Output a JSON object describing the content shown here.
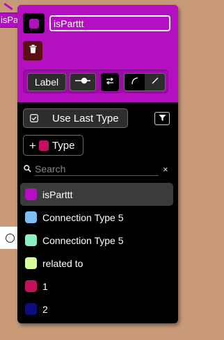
{
  "canvas": {
    "tag_label": "isPartt"
  },
  "editor": {
    "color": "#b40fc0",
    "name_value": "isParttt",
    "delete_icon": "trash-icon",
    "toolbar": {
      "label_button": "Label",
      "arrow_icon": "arrow-direction-icon",
      "swap_icon": "swap-icon",
      "curve_icon": "curved-line-icon",
      "straight_icon": "straight-line-icon"
    },
    "use_last_type_label": "Use Last Type",
    "filter_icon": "filter-icon",
    "add_type": {
      "plus": "+",
      "color": "#c4115e",
      "label": "Type"
    },
    "search": {
      "placeholder": "Search",
      "clear": "×"
    },
    "types": [
      {
        "label": "isParttt",
        "color": "#b40fc0",
        "selected": true
      },
      {
        "label": "Connection Type 5",
        "color": "#7dbdf0",
        "selected": false
      },
      {
        "label": "Connection Type 5",
        "color": "#8cf0c0",
        "selected": false
      },
      {
        "label": "related to",
        "color": "#d8fca0",
        "selected": false
      },
      {
        "label": "1",
        "color": "#c4115e",
        "selected": false
      },
      {
        "label": "2",
        "color": "#0c0e7a",
        "selected": false
      }
    ]
  }
}
